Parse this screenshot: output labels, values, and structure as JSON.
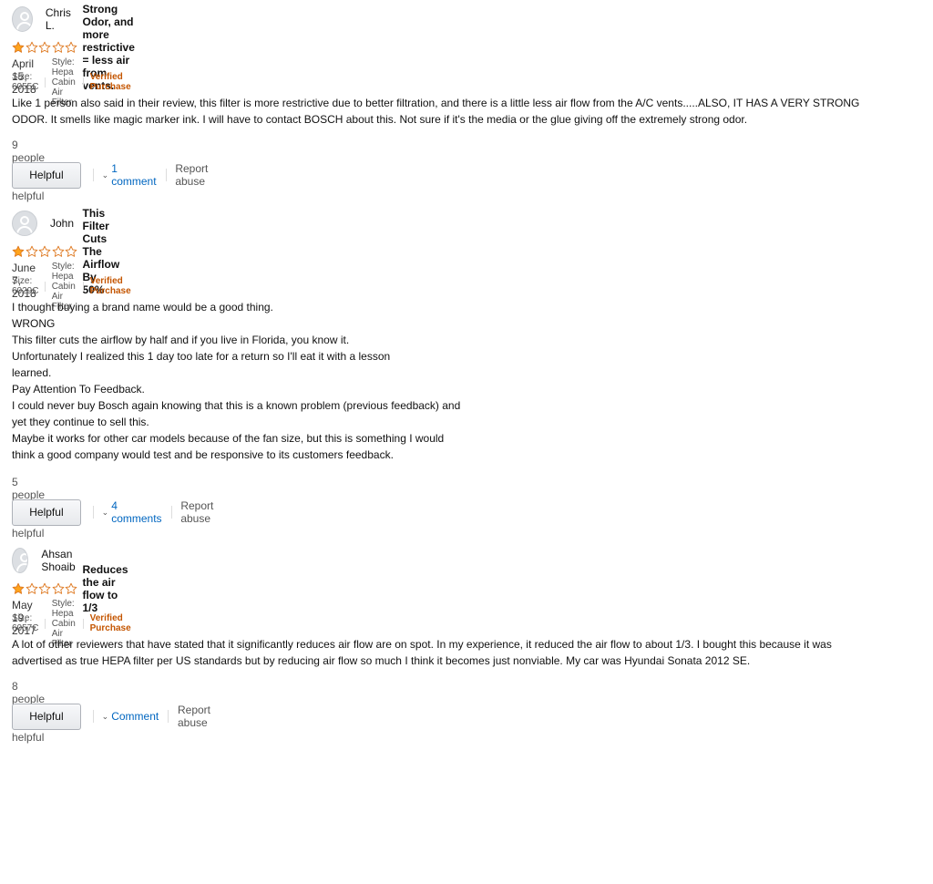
{
  "colors": {
    "star_filled": "#ffa41c",
    "star_outline": "#de7921",
    "verified": "#c45500",
    "link": "#0066c0"
  },
  "reviews": [
    {
      "profile_name": "Chris L.",
      "rating": 1,
      "rating_max": 5,
      "title": "Strong Odor, and more restrictive = less air from vents.",
      "date": "April 15, 2018",
      "size": "Size: 6055C",
      "style": "Style: Hepa Cabin Air Filter",
      "verified": "Verified Purchase",
      "body": [
        "Like 1 person also said in their review, this filter is more restrictive due to better filtration, and there is a little less air flow from the A/C vents.....ALSO, IT HAS A VERY STRONG",
        "ODOR. It smells like magic marker ink. I will have to contact BOSCH about this. Not sure if it's the media or the glue giving off the extremely strong odor."
      ],
      "helpful_count": "9 people found this helpful",
      "helpful_label": "Helpful",
      "comments_label": "1 comment",
      "report_label": "Report abuse"
    },
    {
      "profile_name": "John",
      "rating": 1,
      "rating_max": 5,
      "title": "This Filter Cuts The Airflow By 50%",
      "date": "June 7, 2018",
      "size": "Size: 6029C",
      "style": "Style: Hepa Cabin Air Filter",
      "verified": "Verified Purchase",
      "body": [
        "I thought buying a brand name would be a good thing.",
        "WRONG",
        "This filter cuts the airflow by half and if you live in Florida, you know it.",
        "Unfortunately I realized this 1 day too late for a return so I'll eat it with a lesson",
        "learned.",
        "Pay Attention To Feedback.",
        "I could never buy Bosch again knowing that this is a known problem (previous feedback) and",
        "yet they continue to sell this.",
        "Maybe it works for other car models because of the fan size, but this is something I would",
        "think a good company would test and be responsive to its customers feedback."
      ],
      "helpful_count": "5 people found this helpful",
      "helpful_label": "Helpful",
      "comments_label": "4 comments",
      "report_label": "Report abuse"
    },
    {
      "profile_name": "Ahsan Shoaib",
      "rating": 1,
      "rating_max": 5,
      "title": "Reduces the air flow to 1/3",
      "date": "May 19, 2017",
      "size": "Size: 6057C",
      "style": "Style: Hepa Cabin Air Filter",
      "verified": "Verified Purchase",
      "body": [
        "A lot of other reviewers that have stated that it significantly reduces air flow are on spot. In my experience, it reduced the air flow to about 1/3. I bought this because it was",
        "advertised as true HEPA filter per US standards but by reducing air flow so much I think it becomes just nonviable. My car was Hyundai Sonata 2012 SE."
      ],
      "helpful_count": "8 people found this helpful",
      "helpful_label": "Helpful",
      "comments_label": "Comment",
      "report_label": "Report abuse"
    }
  ]
}
